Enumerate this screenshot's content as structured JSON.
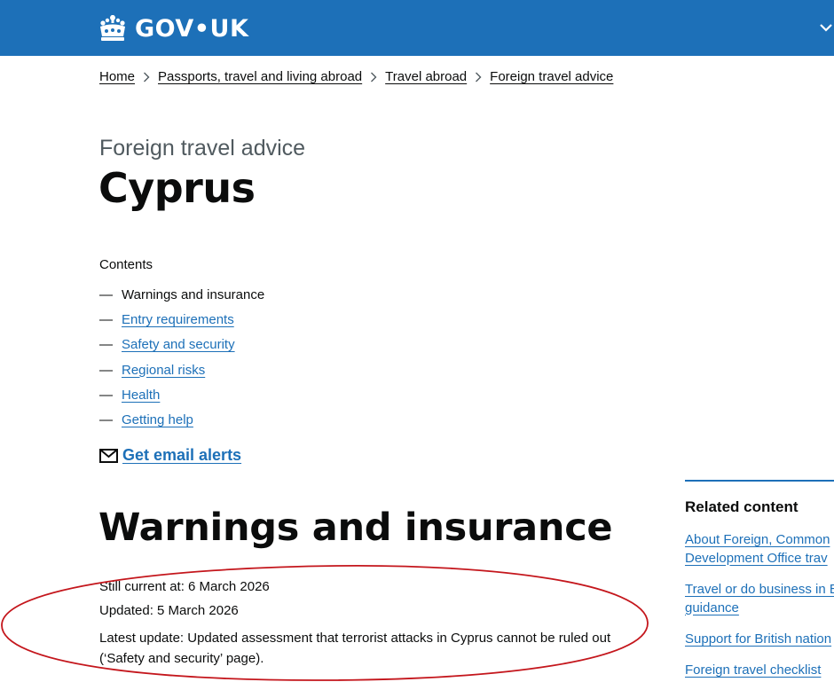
{
  "header": {
    "logo_text": "GOV•UK",
    "brand_color": "#1d70b8",
    "menu_icon": "chevron-down-icon"
  },
  "breadcrumb": [
    {
      "label": "Home"
    },
    {
      "label": "Passports, travel and living abroad"
    },
    {
      "label": "Travel abroad"
    },
    {
      "label": "Foreign travel advice"
    }
  ],
  "page": {
    "caption": "Foreign travel advice",
    "title": "Cyprus"
  },
  "contents": {
    "label": "Contents",
    "items": [
      {
        "label": "Warnings and insurance",
        "current": true
      },
      {
        "label": "Entry requirements",
        "current": false
      },
      {
        "label": "Safety and security",
        "current": false
      },
      {
        "label": "Regional risks",
        "current": false
      },
      {
        "label": "Health",
        "current": false
      },
      {
        "label": "Getting help",
        "current": false
      }
    ]
  },
  "alerts": {
    "icon": "mail-icon",
    "label": "Get email alerts"
  },
  "section": {
    "heading": "Warnings and insurance",
    "still_current": "Still current at:  6 March 2026",
    "updated": "Updated:  5 March 2026",
    "latest_update": "Latest update:  Updated assessment that terrorist attacks in Cyprus cannot be ruled out (‘Safety and security’ page)."
  },
  "related": {
    "heading": "Related content",
    "links": [
      {
        "label": "About Foreign, Common",
        "label2": "Development Office trav"
      },
      {
        "label": "Travel or do business in E",
        "label2": "guidance"
      },
      {
        "label": "Support for British nation",
        "label2": ""
      },
      {
        "label": "Foreign travel checklist",
        "label2": ""
      }
    ]
  },
  "annotation": {
    "ellipse_color": "#c4161c"
  }
}
